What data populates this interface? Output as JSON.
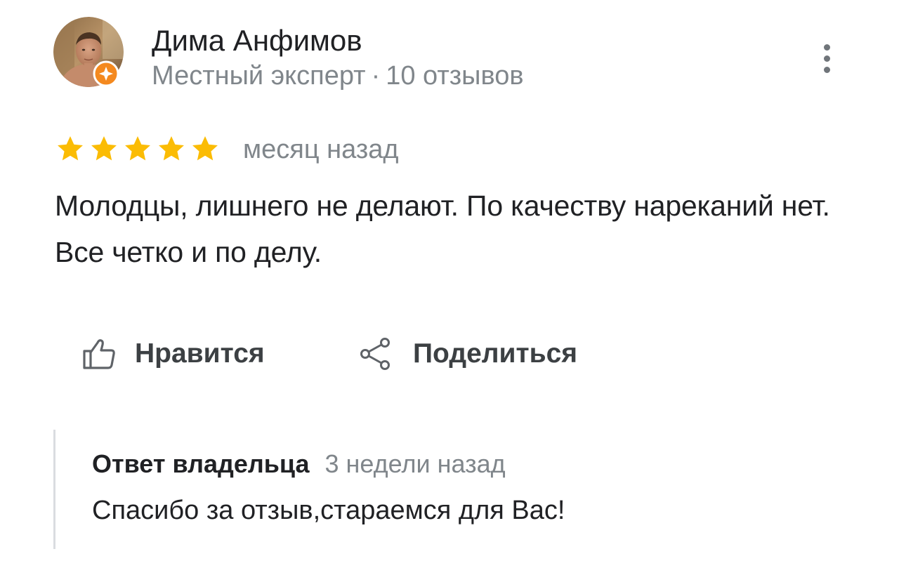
{
  "review": {
    "author": {
      "name": "Дима Анфимов",
      "role": "Местный эксперт",
      "separator": "·",
      "reviews_count": "10 отзывов",
      "avatar": "user-photo",
      "badge_icon": "local-guide-badge-icon",
      "badge_color": "#f4891f"
    },
    "menu_icon": "more-vert-icon",
    "rating": {
      "stars": 5,
      "max_stars": 5,
      "star_color": "#fbbc04"
    },
    "date": "месяц назад",
    "text": "Молодцы, лишнего не делают. По качеству нареканий нет. Все четко и по делу.",
    "actions": {
      "like_icon": "thumb-up-icon",
      "like_label": "Нравится",
      "share_icon": "share-icon",
      "share_label": "Поделиться"
    },
    "owner_reply": {
      "label": "Ответ владельца",
      "date": "3 недели назад",
      "text": "Спасибо за отзыв,стараемся для Вас!"
    }
  }
}
